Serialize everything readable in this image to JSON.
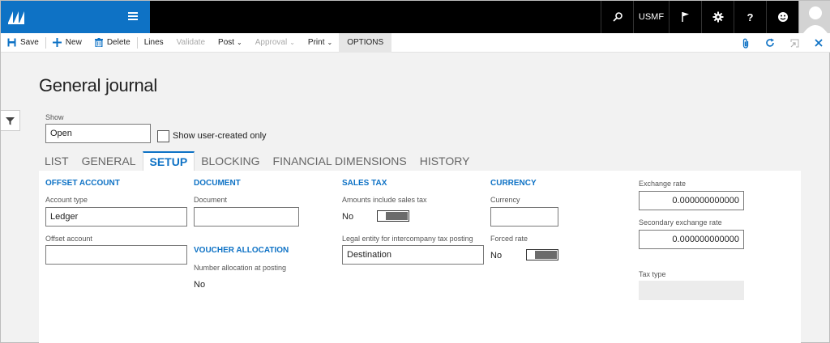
{
  "nav": {
    "company": "USMF",
    "icons": [
      "search-icon",
      "flag-icon",
      "gear-icon",
      "help-icon",
      "smiley-icon"
    ]
  },
  "actions": {
    "save": "Save",
    "new": "New",
    "delete": "Delete",
    "lines": "Lines",
    "validate": "Validate",
    "post": "Post",
    "approval": "Approval",
    "print": "Print",
    "options": "OPTIONS"
  },
  "page": {
    "title": "General journal",
    "show_label": "Show",
    "show_value": "Open",
    "user_created_label": "Show user-created only"
  },
  "tabs": [
    "LIST",
    "GENERAL",
    "SETUP",
    "BLOCKING",
    "FINANCIAL DIMENSIONS",
    "HISTORY"
  ],
  "active_tab": "SETUP",
  "setup": {
    "offset_account": {
      "title": "OFFSET ACCOUNT",
      "account_type_label": "Account type",
      "account_type_value": "Ledger",
      "offset_account_label": "Offset account",
      "offset_account_value": ""
    },
    "document": {
      "title": "DOCUMENT",
      "document_label": "Document",
      "document_value": ""
    },
    "voucher_allocation": {
      "title": "VOUCHER ALLOCATION",
      "number_allocation_label": "Number allocation at posting",
      "number_allocation_value": "No"
    },
    "sales_tax": {
      "title": "SALES TAX",
      "amounts_include_label": "Amounts include sales tax",
      "amounts_include_value": "No",
      "legal_entity_label": "Legal entity for intercompany tax posting",
      "legal_entity_value": "Destination"
    },
    "currency": {
      "title": "CURRENCY",
      "currency_label": "Currency",
      "currency_value": "",
      "forced_rate_label": "Forced rate",
      "forced_rate_value": "No"
    },
    "rates": {
      "exchange_rate_label": "Exchange rate",
      "exchange_rate_value": "0.000000000000",
      "secondary_rate_label": "Secondary exchange rate",
      "secondary_rate_value": "0.000000000000",
      "tax_type_label": "Tax type",
      "tax_type_value": ""
    }
  },
  "colors": {
    "accent": "#0e72c5",
    "navbar": "#000000"
  }
}
